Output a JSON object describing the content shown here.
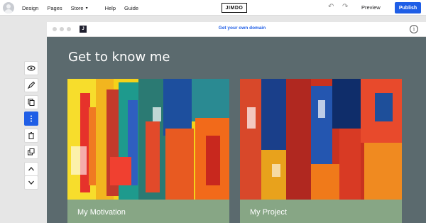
{
  "topbar": {
    "nav": [
      {
        "label": "Design"
      },
      {
        "label": "Pages"
      },
      {
        "label": "Store"
      },
      {
        "label": "Help"
      },
      {
        "label": "Guide"
      }
    ],
    "logo": "JIMDO",
    "preview_label": "Preview",
    "publish_label": "Publish"
  },
  "frame": {
    "site_icon": "J",
    "domain_link": "Get your own domain",
    "info_icon": "i"
  },
  "page": {
    "heading": "Get to know me",
    "cards": [
      {
        "caption": "My Motivation"
      },
      {
        "caption": "My Project"
      }
    ]
  },
  "toolbar": {
    "buttons": [
      "eye-icon",
      "brush-icon",
      "copy-icon",
      "more-vertical-icon",
      "trash-icon",
      "duplicate-icon",
      "chevron-up-icon",
      "chevron-down-icon"
    ]
  },
  "colors": {
    "accent": "#1f5ee6",
    "canvas": "#5b6a6e",
    "caption": "#87a685"
  }
}
